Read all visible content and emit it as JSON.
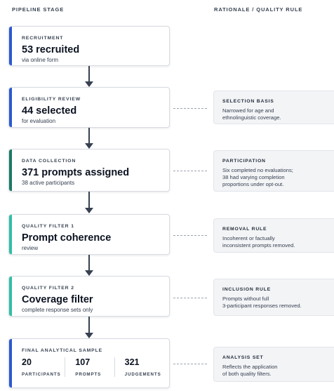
{
  "headers": {
    "left": "PIPELINE STAGE",
    "right": "RATIONALE / QUALITY RULE"
  },
  "stages": [
    {
      "label": "RECRUITMENT",
      "value": "53 recruited",
      "sub": "via online form",
      "accent": "#2b59d1"
    },
    {
      "label": "ELIGIBILITY REVIEW",
      "value": "44 selected",
      "sub": "for evaluation",
      "accent": "#2b59d1"
    },
    {
      "label": "DATA COLLECTION",
      "value": "371 prompts assigned",
      "sub": "38 active participants",
      "accent": "#1a7a64"
    },
    {
      "label": "QUALITY FILTER 1",
      "value": "Prompt coherence",
      "sub": "review",
      "accent": "#2fbfa5"
    },
    {
      "label": "QUALITY FILTER 2",
      "value": "Coverage filter",
      "sub": "complete response sets only",
      "accent": "#2fbfa5"
    },
    {
      "label": "FINAL ANALYTICAL SAMPLE",
      "accent": "#2b59d1",
      "stats": [
        {
          "value": "20",
          "label": "PARTICIPANTS"
        },
        {
          "value": "107",
          "label": "PROMPTS"
        },
        {
          "value": "321",
          "label": "JUDGEMENTS"
        }
      ]
    }
  ],
  "notes": [
    {
      "label": "SELECTION BASIS",
      "text": "Narrowed for age and\nethnolinguistic coverage."
    },
    {
      "label": "PARTICIPATION",
      "text": "Six completed no evaluations;\n38 had varying completion\nproportions under opt-out."
    },
    {
      "label": "REMOVAL RULE",
      "text": "Incoherent or factually\ninconsistent prompts removed."
    },
    {
      "label": "INCLUSION RULE",
      "text": "Prompts without full\n3-participant responses removed."
    },
    {
      "label": "ANALYSIS SET",
      "text": "Reflects the application\nof both quality filters."
    }
  ]
}
